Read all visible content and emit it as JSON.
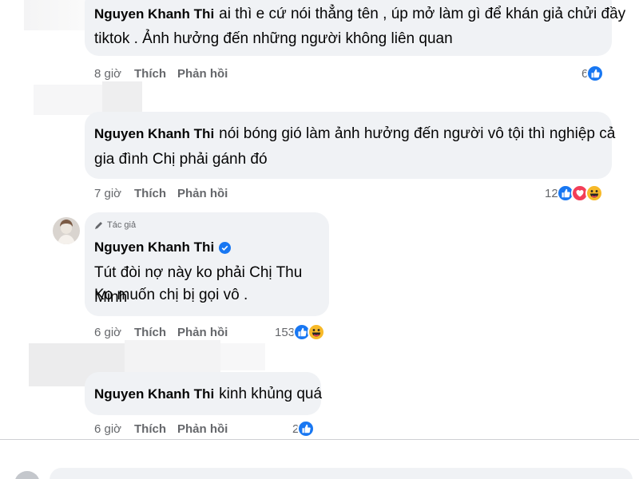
{
  "comments": [
    {
      "name": "Nguyen Khanh Thi",
      "line1": "ai thì e cứ nói thẳng tên , úp mở làm gì để khán giả chửi đầy",
      "line2": "tiktok . Ảnh hưởng đến những người không liên quan",
      "time": "8 giờ",
      "like": "Thích",
      "reply": "Phản hồi",
      "reaction_count": "6",
      "reactions": [
        "like-icon"
      ]
    },
    {
      "name": "Nguyen Khanh Thi",
      "line1": "nói bóng gió làm ảnh hưởng đến người vô tội thì nghiệp cả",
      "line2": "gia đình Chị phải gánh đó",
      "time": "7 giờ",
      "like": "Thích",
      "reply": "Phản hồi",
      "reaction_count": "12",
      "reactions": [
        "like-icon",
        "love-icon",
        "haha-icon"
      ]
    },
    {
      "author_badge": "Tác giả",
      "name": "Nguyen Khanh Thi",
      "line1": "Tút đòi nợ này ko phải Chị Thu Minh",
      "line2": "Ko muốn chị bị gọi vô .",
      "time": "6 giờ",
      "like": "Thích",
      "reply": "Phản hồi",
      "reaction_count": "153",
      "reactions": [
        "like-icon",
        "haha-icon"
      ]
    },
    {
      "name": "Nguyen Khanh Thi",
      "line1": "kinh khủng quá",
      "time": "6 giờ",
      "like": "Thích",
      "reply": "Phản hồi",
      "reaction_count": "2",
      "reactions": [
        "like-icon"
      ]
    }
  ],
  "colors": {
    "bubble": "#f0f2f5",
    "meta_text": "#65676b",
    "like_blue": "#1877f2",
    "verified_blue": "#1877f2",
    "love_red": "#f33e58",
    "haha_yellow": "#f7b928"
  }
}
